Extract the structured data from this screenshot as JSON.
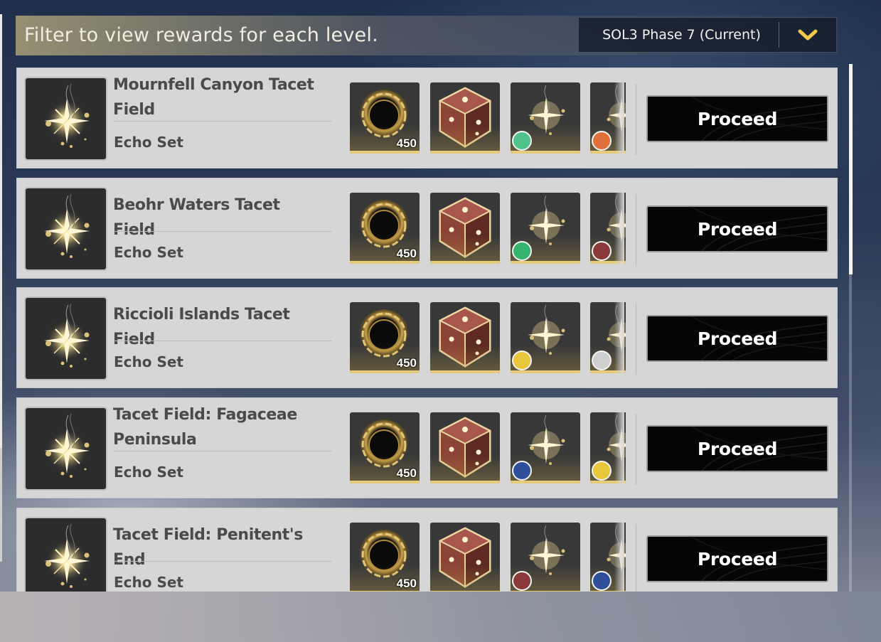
{
  "header": {
    "title": "Filter to view rewards for each level.",
    "selected_phase": "SOL3 Phase 7 (Current)"
  },
  "levels": [
    {
      "title": "Mournfell Canyon Tacet Field",
      "subtitle": "Echo Set",
      "rewards": [
        {
          "icon": "shell-credit-ring-icon",
          "count": "450"
        },
        {
          "icon": "exp-crystal-dice-icon",
          "count": ""
        },
        {
          "icon": "echo-sparkle-icon",
          "badge": "green-lotus-badge",
          "badge_color": "#4fc38a"
        },
        {
          "icon": "echo-sparkle-icon",
          "badge": "orange-swirl-badge",
          "badge_color": "#e0703a"
        }
      ],
      "button": "Proceed"
    },
    {
      "title": "Beohr Waters Tacet Field",
      "subtitle": "Echo Set",
      "rewards": [
        {
          "icon": "shell-credit-ring-icon",
          "count": "450"
        },
        {
          "icon": "exp-crystal-dice-icon",
          "count": ""
        },
        {
          "icon": "echo-sparkle-icon",
          "badge": "green-wind-badge",
          "badge_color": "#35b46e"
        },
        {
          "icon": "echo-sparkle-icon",
          "badge": "maroon-figure-badge",
          "badge_color": "#8a3a3a"
        }
      ],
      "button": "Proceed"
    },
    {
      "title": "Riccioli Islands Tacet Field",
      "subtitle": "Echo Set",
      "rewards": [
        {
          "icon": "shell-credit-ring-icon",
          "count": "450"
        },
        {
          "icon": "exp-crystal-dice-icon",
          "count": ""
        },
        {
          "icon": "echo-sparkle-icon",
          "badge": "yellow-sun-badge",
          "badge_color": "#e9c73c"
        },
        {
          "icon": "echo-sparkle-icon",
          "badge": "white-target-badge",
          "badge_color": "#cfcfcf"
        }
      ],
      "button": "Proceed"
    },
    {
      "title": "Tacet Field: Fagaceae Peninsula",
      "subtitle": "Echo Set",
      "rewards": [
        {
          "icon": "shell-credit-ring-icon",
          "count": "450"
        },
        {
          "icon": "exp-crystal-dice-icon",
          "count": ""
        },
        {
          "icon": "echo-sparkle-icon",
          "badge": "blue-star-badge",
          "badge_color": "#2f4f9a"
        },
        {
          "icon": "echo-sparkle-icon",
          "badge": "yellow-sun-badge",
          "badge_color": "#e9c73c"
        }
      ],
      "button": "Proceed"
    },
    {
      "title": "Tacet Field: Penitent's End",
      "subtitle": "Echo Set",
      "rewards": [
        {
          "icon": "shell-credit-ring-icon",
          "count": "450"
        },
        {
          "icon": "exp-crystal-dice-icon",
          "count": ""
        },
        {
          "icon": "echo-sparkle-icon",
          "badge": "maroon-figure-badge",
          "badge_color": "#8a3a3a"
        },
        {
          "icon": "echo-sparkle-icon",
          "badge": "blue-star-badge",
          "badge_color": "#2f4f9a"
        }
      ],
      "button": "Proceed"
    }
  ],
  "colors": {
    "accent_gold": "#e6cc7a",
    "chevron_gold": "#f2c94c",
    "row_bg": "#d6d6d6",
    "button_bg": "#050505"
  }
}
